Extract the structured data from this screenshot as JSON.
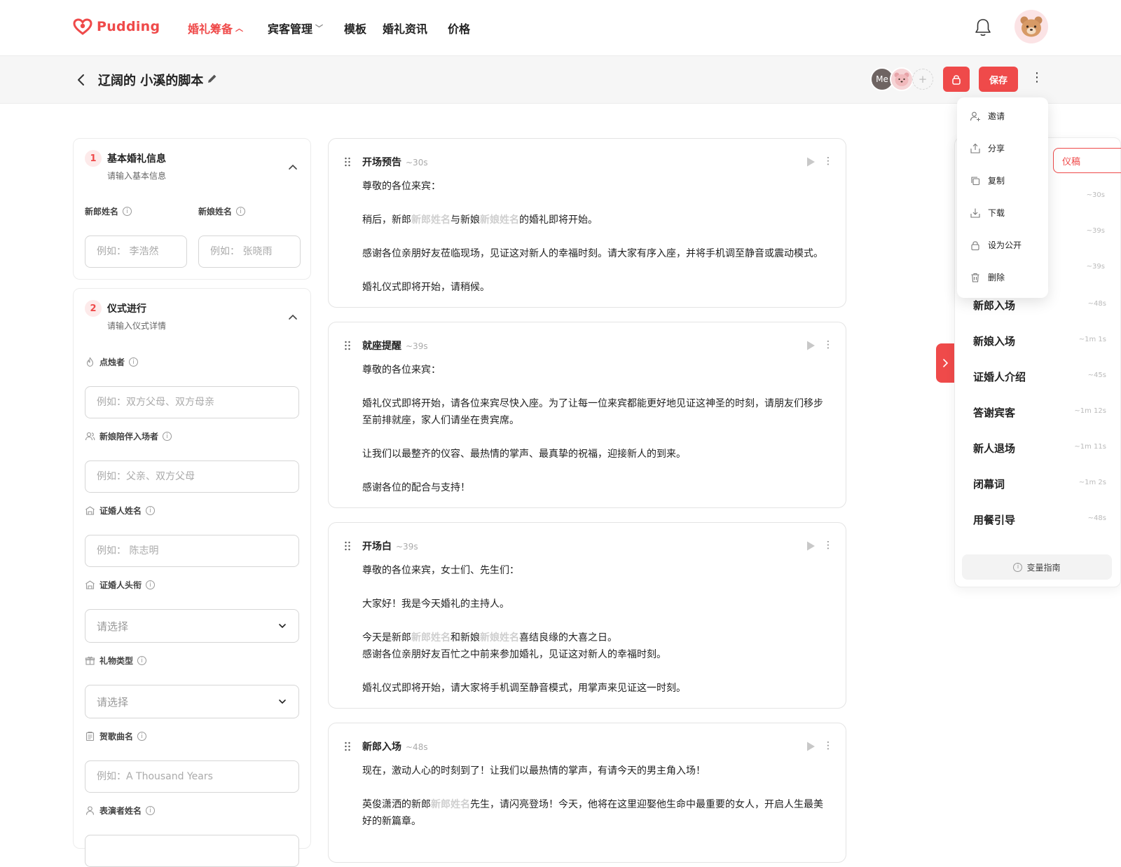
{
  "brand": {
    "name": "Pudding",
    "accent": "#ef4a4a"
  },
  "nav": {
    "items": [
      {
        "label": "婚礼筹备",
        "active": true,
        "dropdown": true
      },
      {
        "label": "宾客管理",
        "active": false,
        "dropdown": true
      },
      {
        "label": "模板",
        "active": false,
        "dropdown": false
      },
      {
        "label": "婚礼资讯",
        "active": false,
        "dropdown": false
      },
      {
        "label": "价格",
        "active": false,
        "dropdown": false
      }
    ]
  },
  "header": {
    "title": "辽阔的 小溪的脚本",
    "me_label": "Me",
    "add_label": "+",
    "save_label": "保存"
  },
  "menu": {
    "items": [
      {
        "label": "邀请",
        "icon": "invite-icon"
      },
      {
        "label": "分享",
        "icon": "share-icon"
      },
      {
        "label": "复制",
        "icon": "copy-icon"
      },
      {
        "label": "下载",
        "icon": "download-icon"
      },
      {
        "label": "设为公开",
        "icon": "lock-icon"
      },
      {
        "label": "删除",
        "icon": "trash-icon"
      }
    ]
  },
  "form": {
    "section1": {
      "num": "1",
      "title": "基本婚礼信息",
      "subtitle": "请输入基本信息",
      "groom_label": "新郎姓名",
      "groom_placeholder": "例如： 李浩然",
      "bride_label": "新娘姓名",
      "bride_placeholder": "例如： 张晓雨"
    },
    "section2": {
      "num": "2",
      "title": "仪式进行",
      "subtitle": "请输入仪式详情",
      "fields": [
        {
          "label": "点烛者",
          "placeholder": "例如：双方父母、双方母亲",
          "type": "input",
          "icon": "flame-icon"
        },
        {
          "label": "新娘陪伴入场者",
          "placeholder": "例如：父亲、双方父母",
          "type": "input",
          "icon": "people-icon"
        },
        {
          "label": "证婚人姓名",
          "placeholder": "例如： 陈志明",
          "type": "input",
          "icon": "building-icon"
        },
        {
          "label": "证婚人头衔",
          "placeholder": "请选择",
          "type": "select",
          "icon": "building-icon"
        },
        {
          "label": "礼物类型",
          "placeholder": "请选择",
          "type": "select",
          "icon": "gift-icon"
        },
        {
          "label": "贺歌曲名",
          "placeholder": "例如：A Thousand Years",
          "type": "input",
          "icon": "clipboard-icon"
        },
        {
          "label": "表演者姓名",
          "placeholder": "",
          "type": "input",
          "icon": "person-icon"
        }
      ]
    }
  },
  "blocks": [
    {
      "title": "开场预告",
      "duration": "~30s",
      "paras": [
        [
          "尊敬的各位来宾："
        ],
        [
          "稍后，新郎",
          {
            "v": "新郎姓名"
          },
          "与新娘",
          {
            "v": "新娘姓名"
          },
          "的婚礼即将开始。"
        ],
        [
          "感谢各位亲朋好友莅临现场，见证这对新人的幸福时刻。请大家有序入座，并将手机调至静音或震动模式。"
        ],
        [
          "婚礼仪式即将开始，请稍候。"
        ]
      ]
    },
    {
      "title": "就座提醒",
      "duration": "~39s",
      "paras": [
        [
          "尊敬的各位来宾："
        ],
        [
          "婚礼仪式即将开始，请各位来宾尽快入座。为了让每一位来宾都能更好地见证这神圣的时刻，请朋友们移步至前排就座，家人们请坐在贵宾席。"
        ],
        [
          "让我们以最整齐的仪容、最热情的掌声、最真挚的祝福，迎接新人的到来。"
        ],
        [
          "感谢各位的配合与支持！"
        ]
      ]
    },
    {
      "title": "开场白",
      "duration": "~39s",
      "paras": [
        [
          "尊敬的各位来宾，女士们、先生们："
        ],
        [
          "大家好！我是今天婚礼的主持人。"
        ],
        [
          "今天是新郎",
          {
            "v": "新郎姓名"
          },
          "和新娘",
          {
            "v": "新娘姓名"
          },
          "喜结良缘的大喜之日。"
        ],
        [
          "感谢各位亲朋好友百忙之中前来参加婚礼，见证这对新人的幸福时刻。"
        ],
        [
          "婚礼仪式即将开始，请大家将手机调至静音模式，用掌声来见证这一时刻。"
        ]
      ]
    },
    {
      "title": "新郎入场",
      "duration": "~48s",
      "paras": [
        [
          "现在，激动人心的时刻到了！让我们以最热情的掌声，有请今天的男主角入场！"
        ],
        [
          "英俊潇洒的新郎",
          {
            "v": "新郎姓名"
          },
          "先生，请闪亮登场！今天，他将在这里迎娶他生命中最重要的女人，开启人生最美好的新篇章。"
        ]
      ]
    }
  ],
  "outline": {
    "button_label": "仪稿",
    "hidden_durations": [
      "~30s",
      "~39s",
      "~39s"
    ],
    "items": [
      {
        "label": "新郎入场",
        "duration": "~48s"
      },
      {
        "label": "新娘入场",
        "duration": "~1m 1s"
      },
      {
        "label": "证婚人介绍",
        "duration": "~45s"
      },
      {
        "label": "答谢宾客",
        "duration": "~1m 12s"
      },
      {
        "label": "新人退场",
        "duration": "~1m 11s"
      },
      {
        "label": "闭幕词",
        "duration": "~1m 2s"
      },
      {
        "label": "用餐引导",
        "duration": "~48s"
      }
    ],
    "guide_label": "变量指南"
  }
}
